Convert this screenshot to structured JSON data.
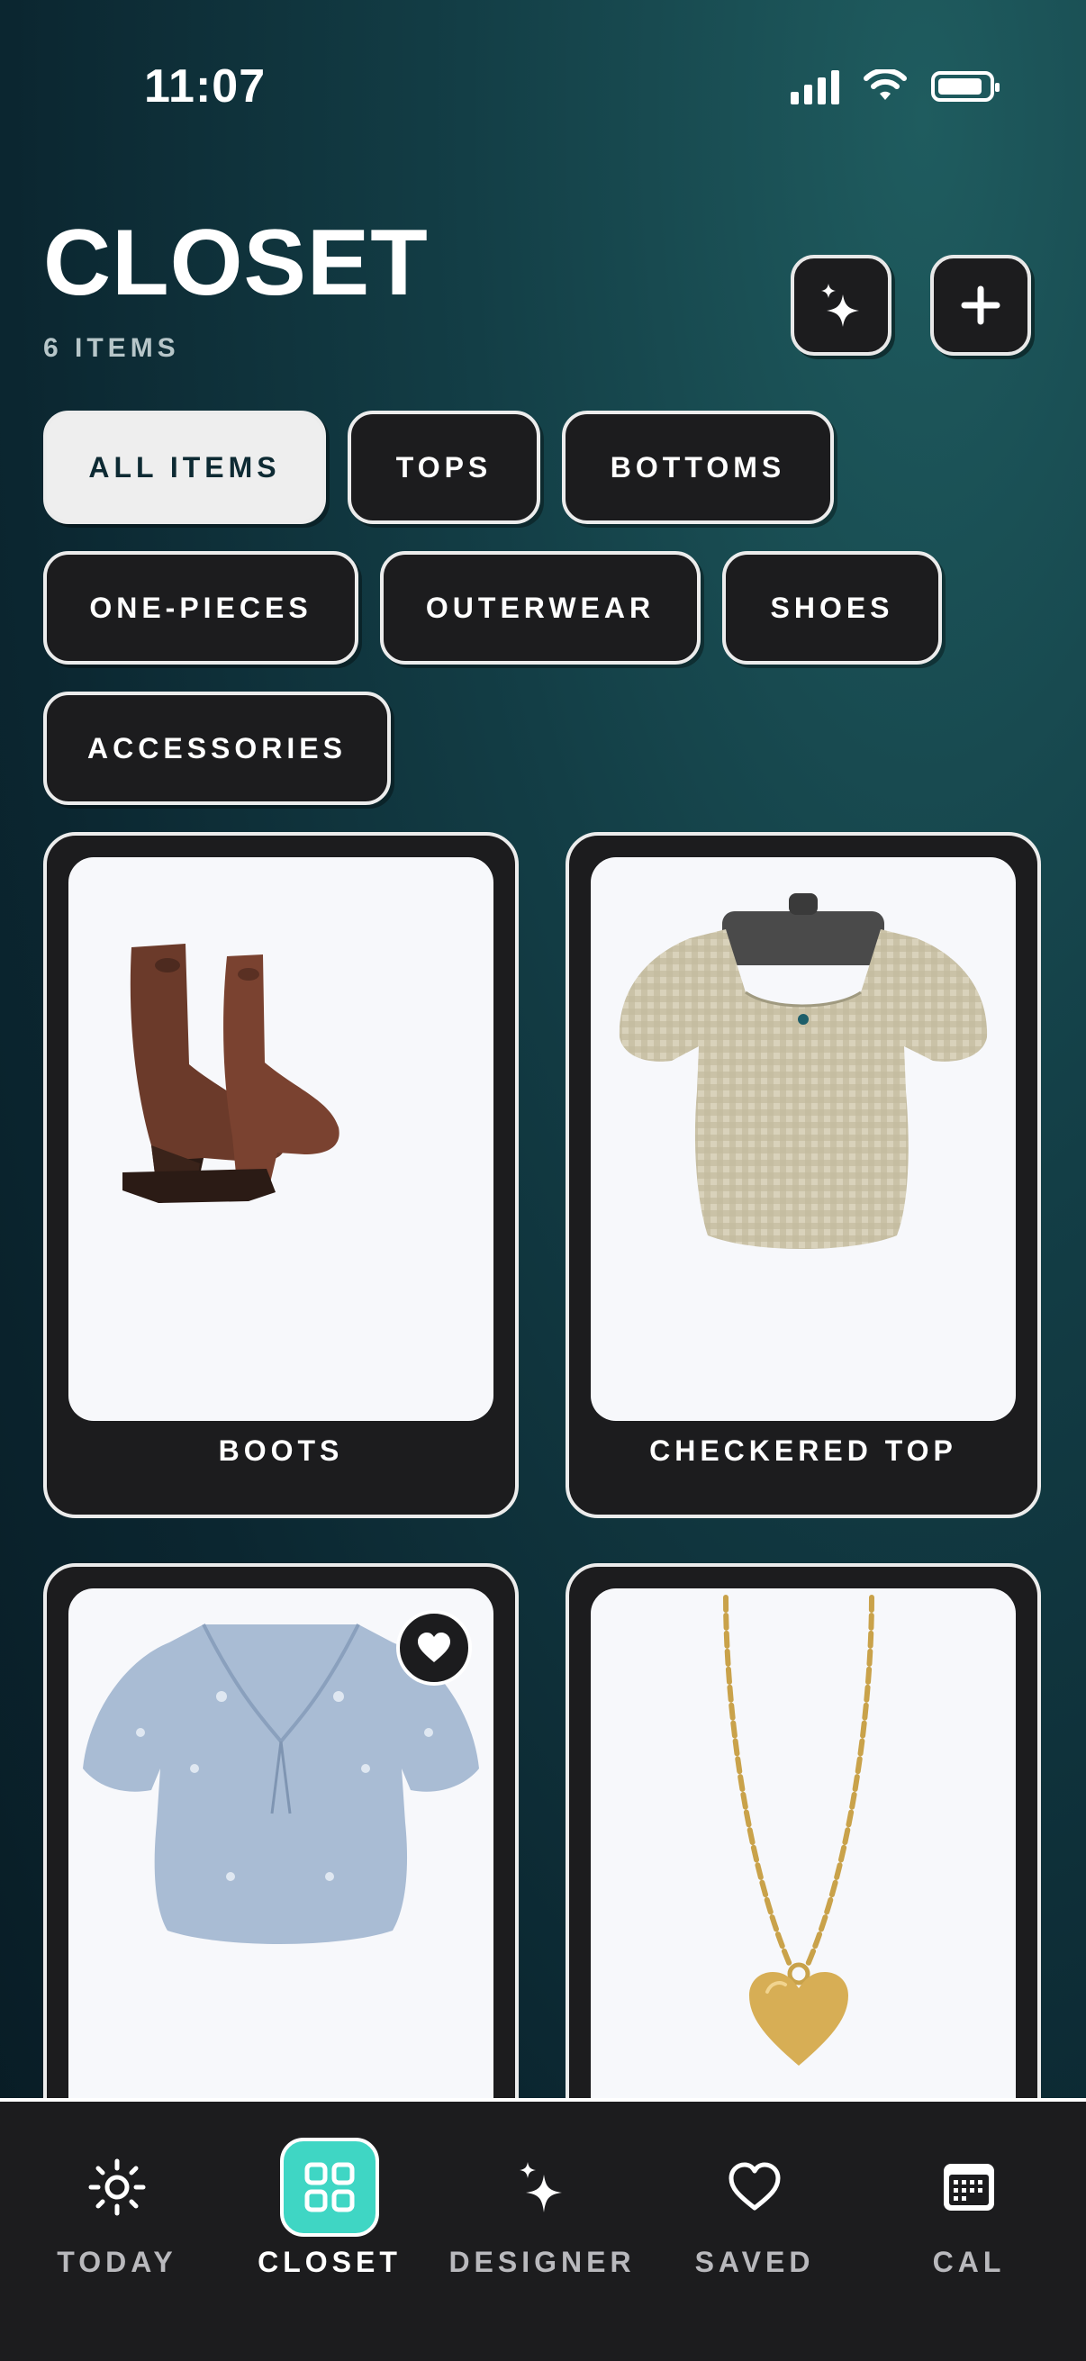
{
  "status": {
    "time": "11:07"
  },
  "header": {
    "title": "CLOSET",
    "item_count": "6 ITEMS"
  },
  "filters": [
    "ALL ITEMS",
    "TOPS",
    "BOTTOMS",
    "ONE-PIECES",
    "OUTERWEAR",
    "SHOES",
    "ACCESSORIES"
  ],
  "active_filter": "ALL ITEMS",
  "items": [
    {
      "label": "BOOTS",
      "favorite": false
    },
    {
      "label": "CHECKERED TOP",
      "favorite": false
    },
    {
      "label": "",
      "favorite": true
    },
    {
      "label": "",
      "favorite": false
    }
  ],
  "tabs": [
    {
      "label": "TODAY",
      "icon": "sun-icon"
    },
    {
      "label": "CLOSET",
      "icon": "grid-icon",
      "active": true
    },
    {
      "label": "DESIGNER",
      "icon": "sparkle-icon"
    },
    {
      "label": "SAVED",
      "icon": "heart-icon"
    },
    {
      "label": "CAL",
      "icon": "calendar-icon"
    }
  ],
  "colors": {
    "accent": "#3fd6c4",
    "card": "#1c1c1e",
    "chip_active": "#eeeeee"
  }
}
